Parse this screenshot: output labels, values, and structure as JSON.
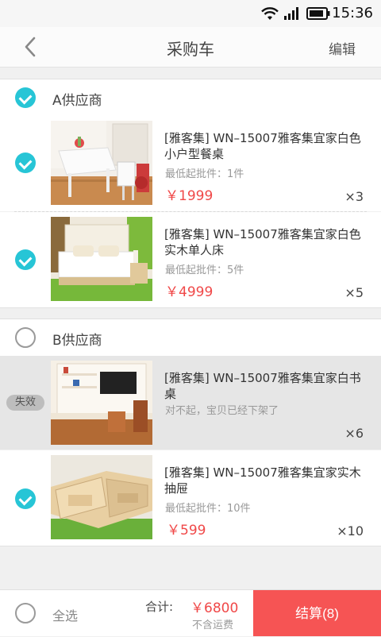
{
  "status_bar": {
    "time": "15:36"
  },
  "nav": {
    "title": "采购车",
    "edit_label": "编辑"
  },
  "suppliers": [
    {
      "name": "A供应商",
      "checked": true,
      "items": [
        {
          "title": "[雅客集] WN–15007雅客集宜家白色小户型餐桌",
          "sub": "最低起批件：1件",
          "price": "￥1999",
          "qty": "×3",
          "checked": true,
          "image": "dining-table-photo"
        },
        {
          "title": "[雅客集] WN–15007雅客集宜家白色实木单人床",
          "sub": "最低起批件：5件",
          "price": "￥4999",
          "qty": "×5",
          "checked": true,
          "image": "single-bed-photo"
        }
      ]
    },
    {
      "name": "B供应商",
      "checked": false,
      "items": [
        {
          "title": "[雅客集] WN–15007雅客集宜家白书桌",
          "sub": "对不起，宝贝已经下架了",
          "qty": "×6",
          "invalid": true,
          "badge": "失效",
          "image": "desk-photo"
        },
        {
          "title": "[雅客集] WN–15007雅客集宜家实木抽屉",
          "sub": "最低起批件：10件",
          "price": "￥599",
          "qty": "×10",
          "checked": true,
          "image": "drawer-photo"
        }
      ]
    }
  ],
  "footer": {
    "select_all_label": "全选",
    "total_label": "合计:",
    "total_value": "￥6800",
    "shipping_note": "不含运费",
    "checkout_label": "结算(8)"
  },
  "colors": {
    "accent": "#27c5d6",
    "price": "#f04848",
    "checkout": "#f65454"
  }
}
